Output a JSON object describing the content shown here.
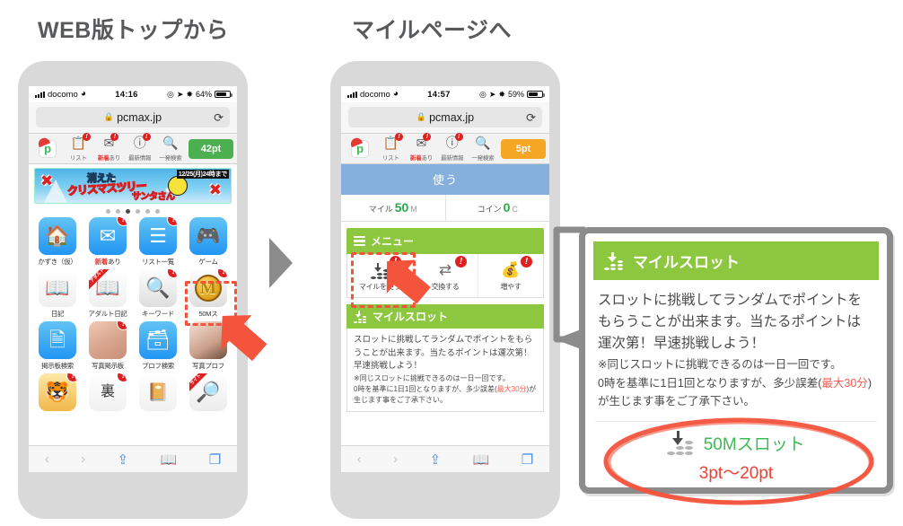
{
  "captions": {
    "left": "WEB版トップから",
    "right": "マイルページへ"
  },
  "phone1": {
    "status": {
      "carrier": "docomo",
      "time": "14:16",
      "battery": "64%"
    },
    "url": {
      "host": "pcmax.jp",
      "lock_icon": "lock-icon",
      "reload_icon": "reload-icon"
    },
    "sitebar": {
      "logo": "p",
      "items": [
        {
          "label": "リスト",
          "badge": "!",
          "icon": "list-icon"
        },
        {
          "label_hot": "新着",
          "label": "あり",
          "badge": "!",
          "icon": "mail-icon"
        },
        {
          "label": "最新情報",
          "badge": "!",
          "icon": "info-icon"
        },
        {
          "label": "一発検索",
          "badge": "",
          "icon": "search-icon"
        }
      ],
      "points": "42pt",
      "points_color": "#4caf50"
    },
    "banner": {
      "date": "12/25(月)24時まで",
      "line1": "消えた",
      "line2": "クリスマスツリー",
      "line3": "サンタさん"
    },
    "carousel_dots": 6,
    "carousel_active": 2,
    "grid": [
      {
        "label": "かずき（仮）",
        "icon": "home-icon",
        "style": "blue",
        "glyph": "🏠",
        "badge": ""
      },
      {
        "label_hot": "新着",
        "label": "あり",
        "icon": "mail-icon",
        "style": "blue",
        "glyph": "✉",
        "badge": "!"
      },
      {
        "label": "リスト一覧",
        "icon": "list-icon",
        "style": "blue",
        "glyph": "☰",
        "badge": "!"
      },
      {
        "label": "ゲーム",
        "icon": "gamepad-icon",
        "style": "blue",
        "glyph": "🎮",
        "badge": ""
      },
      {
        "label": "日記",
        "icon": "book-icon",
        "style": "note",
        "glyph": "📖",
        "badge": ""
      },
      {
        "label": "アダルト日記",
        "icon": "adult-book-icon",
        "style": "note",
        "glyph": "📖",
        "badge": "",
        "ribbon": "アダルト"
      },
      {
        "label": "キーワード",
        "icon": "magnifier-icon",
        "style": "gray",
        "glyph": "🔍",
        "badge": "!"
      },
      {
        "label": "50Mス",
        "icon": "mile-coin-icon",
        "style": "gray",
        "glyph": "M",
        "badge": "!"
      },
      {
        "label": "掲示板検索",
        "icon": "board-search-icon",
        "style": "blue",
        "glyph": "🗎",
        "badge": ""
      },
      {
        "label": "写真掲示板",
        "icon": "photo-board-icon",
        "style": "photo",
        "glyph": "",
        "badge": "!"
      },
      {
        "label": "プロフ検索",
        "icon": "profile-search-icon",
        "style": "blue",
        "glyph": "📇",
        "badge": ""
      },
      {
        "label": "写真プロフ",
        "icon": "photo-profile-icon",
        "style": "photo2",
        "glyph": "",
        "badge": ""
      },
      {
        "label": "",
        "icon": "tiger-icon",
        "style": "tiger",
        "glyph": "🐯",
        "badge": "!"
      },
      {
        "label": "",
        "icon": "ura-profile-icon",
        "style": "note",
        "glyph": "裏",
        "badge": "!"
      },
      {
        "label": "",
        "icon": "green-book-icon",
        "style": "note",
        "glyph": "📒",
        "badge": ""
      },
      {
        "label": "",
        "icon": "light-search-icon",
        "style": "srch2",
        "glyph": "🔎",
        "badge": "",
        "ribbon": "ライト"
      }
    ],
    "safaribar": [
      "back-icon",
      "forward-icon",
      "share-icon",
      "bookmarks-icon",
      "tabs-icon"
    ]
  },
  "phone2": {
    "status": {
      "carrier": "docomo",
      "time": "14:57",
      "battery": "59%"
    },
    "url": {
      "host": "pcmax.jp",
      "lock_icon": "lock-icon",
      "reload_icon": "reload-icon"
    },
    "sitebar": {
      "items": [
        {
          "label": "リスト",
          "badge": "!"
        },
        {
          "label_hot": "新着",
          "label": "あり",
          "badge": "!"
        },
        {
          "label": "最新情報",
          "badge": "!"
        },
        {
          "label": "一発検索",
          "badge": ""
        }
      ],
      "points": "5pt",
      "points_color": "#f5a623"
    },
    "use_bar": "使う",
    "balances": [
      {
        "label": "マイル",
        "value": "50",
        "unit": "M"
      },
      {
        "label": "コイン",
        "value": "0",
        "unit": "C"
      }
    ],
    "menu": {
      "title": "メニュー",
      "items": [
        {
          "label": "マイルを使う",
          "icon": "coin-stack-icon",
          "badge": "!"
        },
        {
          "label": "交換する",
          "icon": "exchange-icon",
          "badge": "!"
        },
        {
          "label": "増やす",
          "icon": "piggy-bank-icon",
          "badge": "!"
        }
      ]
    },
    "slot": {
      "title": "マイルスロット",
      "desc_main": "スロットに挑戦してランダムでポイントをもらうことが出来ます。当たるポイントは運次第！早速挑戦しよう！",
      "note_line1": "※同じスロットに挑戦できるのは一日一回です。",
      "note_line2_a": "0時を基準に1日1回となりますが、多少誤差(",
      "note_line2_warn": "最大30分",
      "note_line2_b": ")が生じます事をご了承下さい。"
    }
  },
  "detail": {
    "title": "マイルスロット",
    "title_icon": "coin-stack-icon",
    "desc_main": "スロットに挑戦してランダムでポイントをもらうことが出来ます。当たるポイントは運次第！早速挑戦しよう！",
    "note_line1": "※同じスロットに挑戦できるのは一日一回です。",
    "note_line2_a": "0時を基準に1日1回となりますが、多少誤差(",
    "note_line2_warn": "最大30分",
    "note_line2_b": ")が生じます事をご了承下さい。",
    "slot_name": "50Mスロット",
    "slot_name_color": "#3cba54",
    "point_range": "3pt〜20pt",
    "point_range_color": "#ef4136",
    "annotation": "red-ellipse-highlight"
  },
  "annotations": {
    "step_arrow": "gray-step-arrow",
    "red_arrow_1": "red-arrow-pointing-mile-icon",
    "red_arrow_2": "red-arrow-pointing-use-mile",
    "highlight_1": "red-dashed-box-mile-icon",
    "highlight_2": "red-dashed-box-use-mile",
    "connector": "gray-callout-connector"
  }
}
